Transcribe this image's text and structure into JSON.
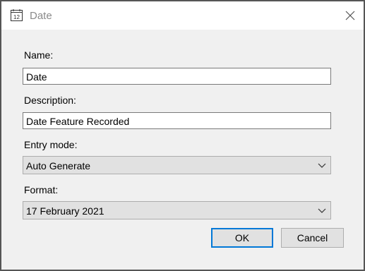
{
  "window": {
    "title": "Date",
    "icon": "calendar-icon",
    "icon_text": "12",
    "close_icon": "close-icon"
  },
  "form": {
    "name_label": "Name:",
    "name_value": "Date",
    "description_label": "Description:",
    "description_value": "Date Feature Recorded",
    "entry_mode_label": "Entry mode:",
    "entry_mode_value": "Auto Generate",
    "format_label": "Format:",
    "format_value": "17 February 2021"
  },
  "buttons": {
    "ok": "OK",
    "cancel": "Cancel"
  },
  "colors": {
    "default_button_border": "#0078d7",
    "client_background": "#f0f0f0",
    "title_text": "#8a8a8a"
  }
}
